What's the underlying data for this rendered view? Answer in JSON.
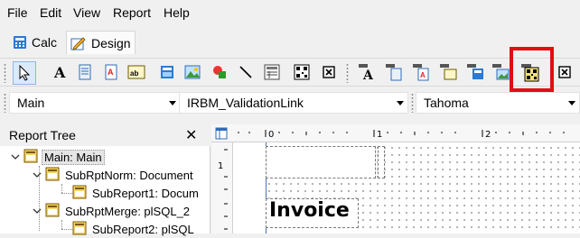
{
  "menu": [
    "File",
    "Edit",
    "View",
    "Report",
    "Help"
  ],
  "tabs": [
    {
      "label": "Calc",
      "icon": "calc-icon",
      "active": false
    },
    {
      "label": "Design",
      "icon": "design-pencil-icon",
      "active": true
    }
  ],
  "toolbar": {
    "left_tools": [
      "pointer-icon",
      "text-label-icon",
      "document-icon",
      "field-icon",
      "rich-text-icon",
      "calc-field-icon",
      "image-icon",
      "shape-icon",
      "line-icon",
      "subreport-icon",
      "barcode-icon",
      "checkbox-icon"
    ],
    "right_tools": [
      "insert-label-band-icon",
      "band-text-icon",
      "band-field-icon",
      "band-calc-icon",
      "band-image-icon",
      "band-shape-icon",
      "band-subreport-icon",
      "band-barcode-icon",
      "band-checkbox-icon"
    ]
  },
  "combos": {
    "section": "Main",
    "datasource": "IRBM_ValidationLink",
    "font": "Tahoma"
  },
  "tree": {
    "title": "Report Tree",
    "close": "✕",
    "items": [
      {
        "label": "Main: Main",
        "level": 0,
        "expanded": true,
        "selected": true
      },
      {
        "label": "SubRptNorm: Document",
        "level": 1,
        "expanded": true,
        "selected": false
      },
      {
        "label": "SubReport1: Docum",
        "level": 2,
        "expanded": null,
        "selected": false
      },
      {
        "label": "SubRptMerge: plSQL_2",
        "level": 1,
        "expanded": true,
        "selected": false
      },
      {
        "label": "SubReport2: plSQL",
        "level": 2,
        "expanded": null,
        "selected": false
      }
    ]
  },
  "ruler": {
    "top_marks": [
      "0",
      "1",
      "2"
    ],
    "left_marks": [
      "1"
    ]
  },
  "design": {
    "invoice_label": "Invoice"
  },
  "colors": {
    "highlight": "#e10f12",
    "accent": "#4b73c0"
  }
}
